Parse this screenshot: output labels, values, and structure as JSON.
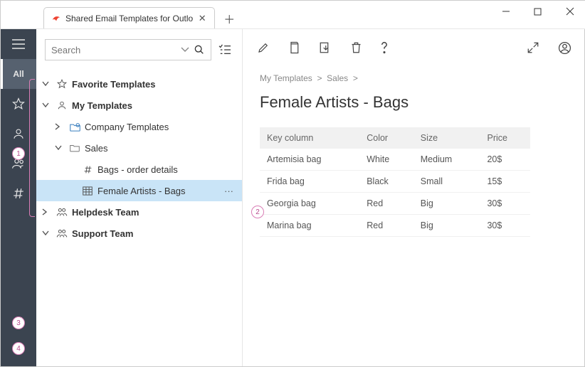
{
  "tab": {
    "title": "Shared Email Templates for Outlo"
  },
  "search": {
    "placeholder": "Search"
  },
  "sidebar": {
    "all_label": "All"
  },
  "tree": {
    "favorite": "Favorite Templates",
    "my": "My Templates",
    "company": "Company Templates",
    "sales": "Sales",
    "bags_order": "Bags - order details",
    "female_bags": "Female Artists - Bags",
    "helpdesk": "Helpdesk Team",
    "support": "Support Team"
  },
  "breadcrumb": {
    "a": "My Templates",
    "b": "Sales"
  },
  "page_title": "Female Artists - Bags",
  "table": {
    "headers": {
      "key": "Key column",
      "color": "Color",
      "size": "Size",
      "price": "Price"
    },
    "rows": [
      {
        "key": "Artemisia bag",
        "color": "White",
        "size": "Medium",
        "price": "20$"
      },
      {
        "key": "Frida bag",
        "color": "Black",
        "size": "Small",
        "price": "15$"
      },
      {
        "key": "Georgia bag",
        "color": "Red",
        "size": "Big",
        "price": "30$"
      },
      {
        "key": "Marina bag",
        "color": "Red",
        "size": "Big",
        "price": "30$"
      }
    ]
  },
  "callouts": {
    "c1": "1",
    "c2": "2",
    "c3": "3",
    "c4": "4"
  }
}
